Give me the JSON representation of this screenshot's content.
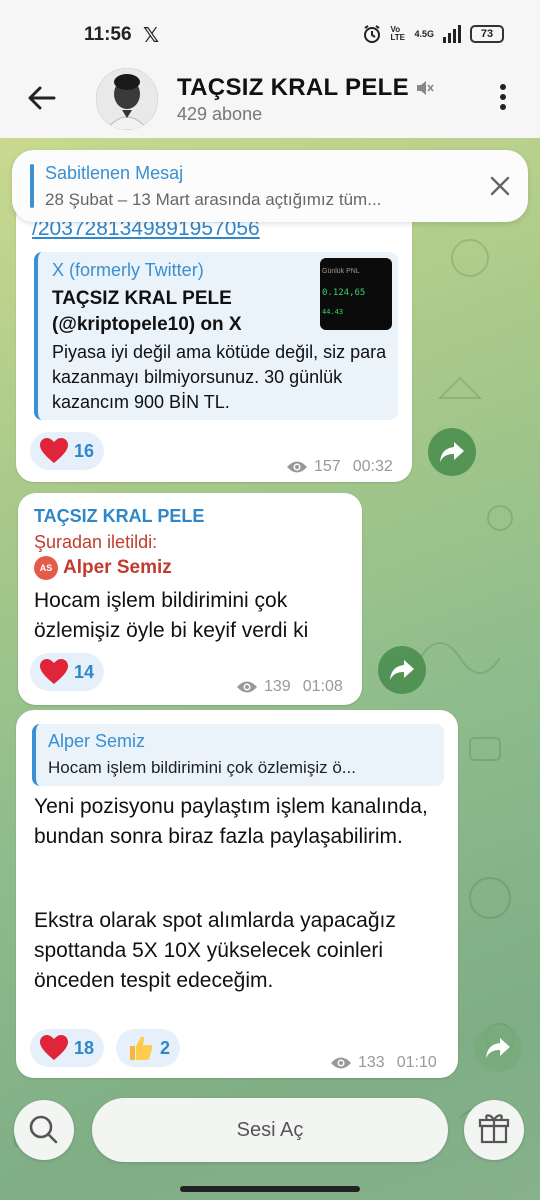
{
  "status_bar": {
    "time": "11:56",
    "x_logo": "𝕏",
    "network": "4.5G",
    "volte": "Vo LTE",
    "battery": "73"
  },
  "header": {
    "title": "TAÇSIZ KRAL PELE",
    "subtitle": "429 abone"
  },
  "pinned": {
    "title": "Sabitlenen Mesaj",
    "text": "28 Şubat – 13 Mart arasında açtığımız  tüm..."
  },
  "messages": [
    {
      "link": "/2037281349891957056",
      "preview": {
        "site": "X (formerly Twitter)",
        "title": "TAÇSIZ KRAL PELE (@kriptopele10) on X",
        "description": "Piyasa iyi değil ama kötüde değil, siz para kazanmayı bilmiyorsunuz. 30 günlük kazancım 900 BİN TL.",
        "thumb_label": "Günlük PNL",
        "thumb_value": "0.124,65",
        "thumb_small": "44.43"
      },
      "reactions": [
        {
          "emoji": "heart",
          "count": "16"
        }
      ],
      "views": "157",
      "time": "00:32"
    },
    {
      "sender": "TAÇSIZ KRAL PELE",
      "forwarded_label": "Şuradan iletildi:",
      "forwarded_initials": "AS",
      "forwarded_name": "Alper Semiz",
      "text": "Hocam işlem bildirimini çok özlemişiz öyle bi keyif verdi ki",
      "reactions": [
        {
          "emoji": "heart",
          "count": "14"
        }
      ],
      "views": "139",
      "time": "01:08"
    },
    {
      "reply_name": "Alper Semiz",
      "reply_text": "Hocam işlem bildirimini çok özlemişiz ö...",
      "text_p1": "Yeni pozisyonu paylaştım işlem kanalında, bundan sonra biraz fazla paylaşabilirim.",
      "text_p2": "Ekstra olarak spot alımlarda yapacağız spottanda 5X 10X yükselecek coinleri önceden tespit edeceğim.",
      "reactions": [
        {
          "emoji": "heart",
          "count": "18"
        },
        {
          "emoji": "thumbs-up",
          "count": "2"
        }
      ],
      "views": "133",
      "time": "01:10"
    }
  ],
  "bottom": {
    "unmute_label": "Sesi Aç"
  },
  "colors": {
    "accent": "#3a90d4",
    "forward_red": "#c23b2e",
    "reaction_bg": "#e6f0fa"
  }
}
